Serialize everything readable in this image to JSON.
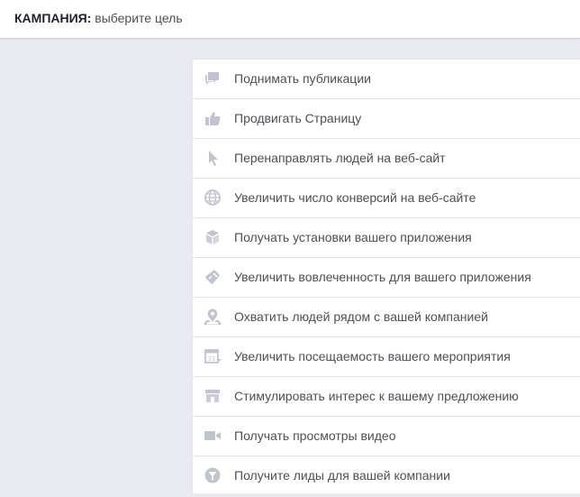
{
  "header": {
    "label": "КАМПАНИЯ:",
    "text": "выберите цель"
  },
  "colors": {
    "icon": "#bfc4d1",
    "text": "#4b4f56",
    "background": "#e9eaef"
  },
  "objectives": [
    {
      "icon": "chat-bubbles-icon",
      "label": "Поднимать публикации"
    },
    {
      "icon": "thumbs-up-icon",
      "label": "Продвигать Страницу"
    },
    {
      "icon": "cursor-icon",
      "label": "Перенаправлять людей на веб-сайт"
    },
    {
      "icon": "globe-icon",
      "label": "Увеличить число конверсий на веб-сайте"
    },
    {
      "icon": "box-icon",
      "label": "Получать установки вашего приложения"
    },
    {
      "icon": "gamepad-icon",
      "label": "Увеличить вовлеченность для вашего приложения"
    },
    {
      "icon": "map-pin-icon",
      "label": "Охватить людей рядом с вашей компанией"
    },
    {
      "icon": "calendar-icon",
      "label": "Увеличить посещаемость вашего мероприятия"
    },
    {
      "icon": "storefront-icon",
      "label": "Стимулировать интерес к вашему предложению"
    },
    {
      "icon": "video-camera-icon",
      "label": "Получать просмотры видео"
    },
    {
      "icon": "funnel-icon",
      "label": "Получите лиды для вашей компании"
    }
  ]
}
